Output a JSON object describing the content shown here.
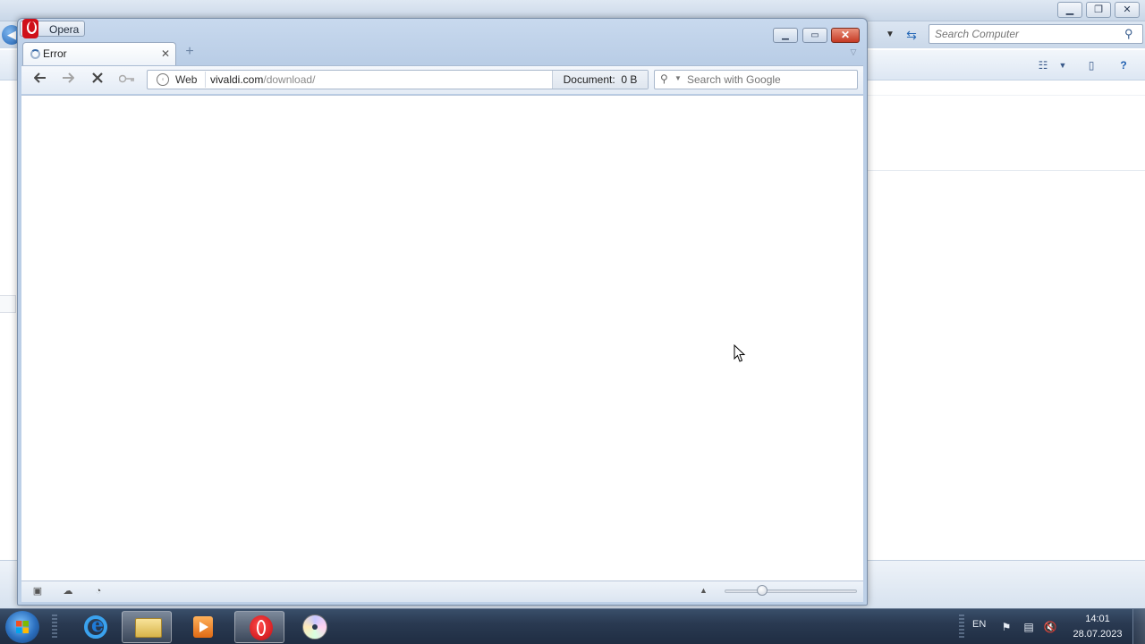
{
  "explorer": {
    "search_placeholder": "Search Computer"
  },
  "opera": {
    "menu_label": "Opera",
    "tab": {
      "title": "Error"
    },
    "address": {
      "scheme_label": "Web",
      "url_host": "vivaldi.com",
      "url_path": "/download/",
      "document_label": "Document:",
      "document_size": "0 B"
    },
    "search_placeholder": "Search with Google"
  },
  "taskbar": {
    "language": "EN",
    "time": "14:01",
    "date": "28.07.2023"
  },
  "icons": {
    "back": "back-arrow-icon",
    "forward": "forward-arrow-icon",
    "stop": "stop-icon",
    "key": "key-icon",
    "new_tab": "plus-icon",
    "search": "magnifier-icon"
  },
  "colors": {
    "opera_red": "#d0101a",
    "close_button": "#c63a24",
    "taskbar": "#2a3a52"
  }
}
